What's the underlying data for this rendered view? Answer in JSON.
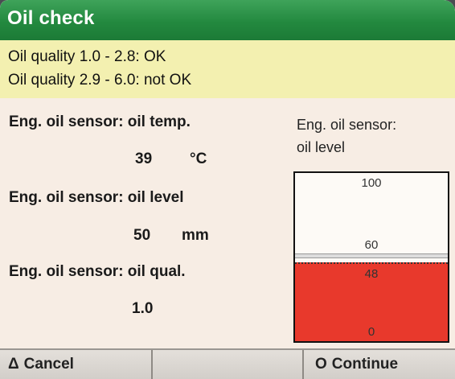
{
  "window": {
    "title": "Oil check"
  },
  "info": {
    "line1": "Oil quality 1.0 - 2.8: OK",
    "line2": "Oil quality 2.9 - 6.0: not OK"
  },
  "readings": {
    "temp": {
      "label": "Eng. oil sensor: oil temp.",
      "value": "39",
      "unit": "°C"
    },
    "level": {
      "label": "Eng. oil sensor: oil level",
      "value": "50",
      "unit": "mm"
    },
    "quality": {
      "label": "Eng. oil sensor: oil qual.",
      "value": "1.0"
    }
  },
  "gauge": {
    "title_line1": "Eng. oil sensor:",
    "title_line2": "oil level",
    "max": 100,
    "min": 0,
    "upper_mark": 60,
    "current": 48,
    "label_max": "100",
    "label_upper": "60",
    "label_current": "48",
    "label_min": "0",
    "fill_color": "#e8392c"
  },
  "softkeys": {
    "cancel": {
      "icon": "triangle-icon",
      "glyph": "Δ",
      "label": "Cancel"
    },
    "middle": {
      "label": ""
    },
    "continue": {
      "icon": "circle-icon",
      "glyph": "O",
      "label": "Continue"
    }
  },
  "colors": {
    "titlebar": "#23893f",
    "info_bg": "#f3f0b0",
    "body_bg": "#f7ede4"
  }
}
